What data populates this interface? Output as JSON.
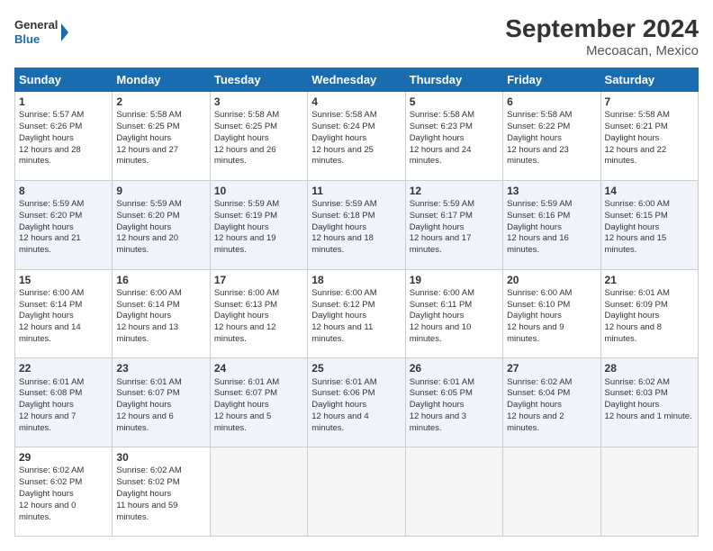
{
  "logo": {
    "line1": "General",
    "line2": "Blue"
  },
  "title": "September 2024",
  "subtitle": "Mecoacan, Mexico",
  "days": [
    "Sunday",
    "Monday",
    "Tuesday",
    "Wednesday",
    "Thursday",
    "Friday",
    "Saturday"
  ],
  "weeks": [
    [
      {
        "day": 1,
        "sr": "5:57 AM",
        "ss": "6:26 PM",
        "dl": "12 hours and 28 minutes."
      },
      {
        "day": 2,
        "sr": "5:58 AM",
        "ss": "6:25 PM",
        "dl": "12 hours and 27 minutes."
      },
      {
        "day": 3,
        "sr": "5:58 AM",
        "ss": "6:25 PM",
        "dl": "12 hours and 26 minutes."
      },
      {
        "day": 4,
        "sr": "5:58 AM",
        "ss": "6:24 PM",
        "dl": "12 hours and 25 minutes."
      },
      {
        "day": 5,
        "sr": "5:58 AM",
        "ss": "6:23 PM",
        "dl": "12 hours and 24 minutes."
      },
      {
        "day": 6,
        "sr": "5:58 AM",
        "ss": "6:22 PM",
        "dl": "12 hours and 23 minutes."
      },
      {
        "day": 7,
        "sr": "5:58 AM",
        "ss": "6:21 PM",
        "dl": "12 hours and 22 minutes."
      }
    ],
    [
      {
        "day": 8,
        "sr": "5:59 AM",
        "ss": "6:20 PM",
        "dl": "12 hours and 21 minutes."
      },
      {
        "day": 9,
        "sr": "5:59 AM",
        "ss": "6:20 PM",
        "dl": "12 hours and 20 minutes."
      },
      {
        "day": 10,
        "sr": "5:59 AM",
        "ss": "6:19 PM",
        "dl": "12 hours and 19 minutes."
      },
      {
        "day": 11,
        "sr": "5:59 AM",
        "ss": "6:18 PM",
        "dl": "12 hours and 18 minutes."
      },
      {
        "day": 12,
        "sr": "5:59 AM",
        "ss": "6:17 PM",
        "dl": "12 hours and 17 minutes."
      },
      {
        "day": 13,
        "sr": "5:59 AM",
        "ss": "6:16 PM",
        "dl": "12 hours and 16 minutes."
      },
      {
        "day": 14,
        "sr": "6:00 AM",
        "ss": "6:15 PM",
        "dl": "12 hours and 15 minutes."
      }
    ],
    [
      {
        "day": 15,
        "sr": "6:00 AM",
        "ss": "6:14 PM",
        "dl": "12 hours and 14 minutes."
      },
      {
        "day": 16,
        "sr": "6:00 AM",
        "ss": "6:14 PM",
        "dl": "12 hours and 13 minutes."
      },
      {
        "day": 17,
        "sr": "6:00 AM",
        "ss": "6:13 PM",
        "dl": "12 hours and 12 minutes."
      },
      {
        "day": 18,
        "sr": "6:00 AM",
        "ss": "6:12 PM",
        "dl": "12 hours and 11 minutes."
      },
      {
        "day": 19,
        "sr": "6:00 AM",
        "ss": "6:11 PM",
        "dl": "12 hours and 10 minutes."
      },
      {
        "day": 20,
        "sr": "6:00 AM",
        "ss": "6:10 PM",
        "dl": "12 hours and 9 minutes."
      },
      {
        "day": 21,
        "sr": "6:01 AM",
        "ss": "6:09 PM",
        "dl": "12 hours and 8 minutes."
      }
    ],
    [
      {
        "day": 22,
        "sr": "6:01 AM",
        "ss": "6:08 PM",
        "dl": "12 hours and 7 minutes."
      },
      {
        "day": 23,
        "sr": "6:01 AM",
        "ss": "6:07 PM",
        "dl": "12 hours and 6 minutes."
      },
      {
        "day": 24,
        "sr": "6:01 AM",
        "ss": "6:07 PM",
        "dl": "12 hours and 5 minutes."
      },
      {
        "day": 25,
        "sr": "6:01 AM",
        "ss": "6:06 PM",
        "dl": "12 hours and 4 minutes."
      },
      {
        "day": 26,
        "sr": "6:01 AM",
        "ss": "6:05 PM",
        "dl": "12 hours and 3 minutes."
      },
      {
        "day": 27,
        "sr": "6:02 AM",
        "ss": "6:04 PM",
        "dl": "12 hours and 2 minutes."
      },
      {
        "day": 28,
        "sr": "6:02 AM",
        "ss": "6:03 PM",
        "dl": "12 hours and 1 minute."
      }
    ],
    [
      {
        "day": 29,
        "sr": "6:02 AM",
        "ss": "6:02 PM",
        "dl": "12 hours and 0 minutes."
      },
      {
        "day": 30,
        "sr": "6:02 AM",
        "ss": "6:02 PM",
        "dl": "11 hours and 59 minutes."
      },
      null,
      null,
      null,
      null,
      null
    ]
  ]
}
